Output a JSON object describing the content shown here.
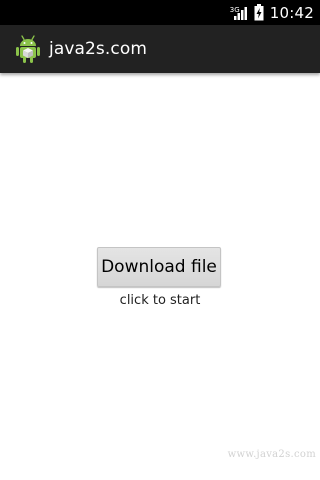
{
  "status_bar": {
    "network_type": "3G",
    "signal_icon": "signal-icon",
    "battery_icon": "battery-icon",
    "time": "10:42"
  },
  "action_bar": {
    "icon": "android-icon",
    "title": "java2s.com",
    "background": "#222222"
  },
  "main": {
    "download_button_label": "Download file",
    "hint_text": "click to start"
  },
  "watermark": "www.java2s.com"
}
